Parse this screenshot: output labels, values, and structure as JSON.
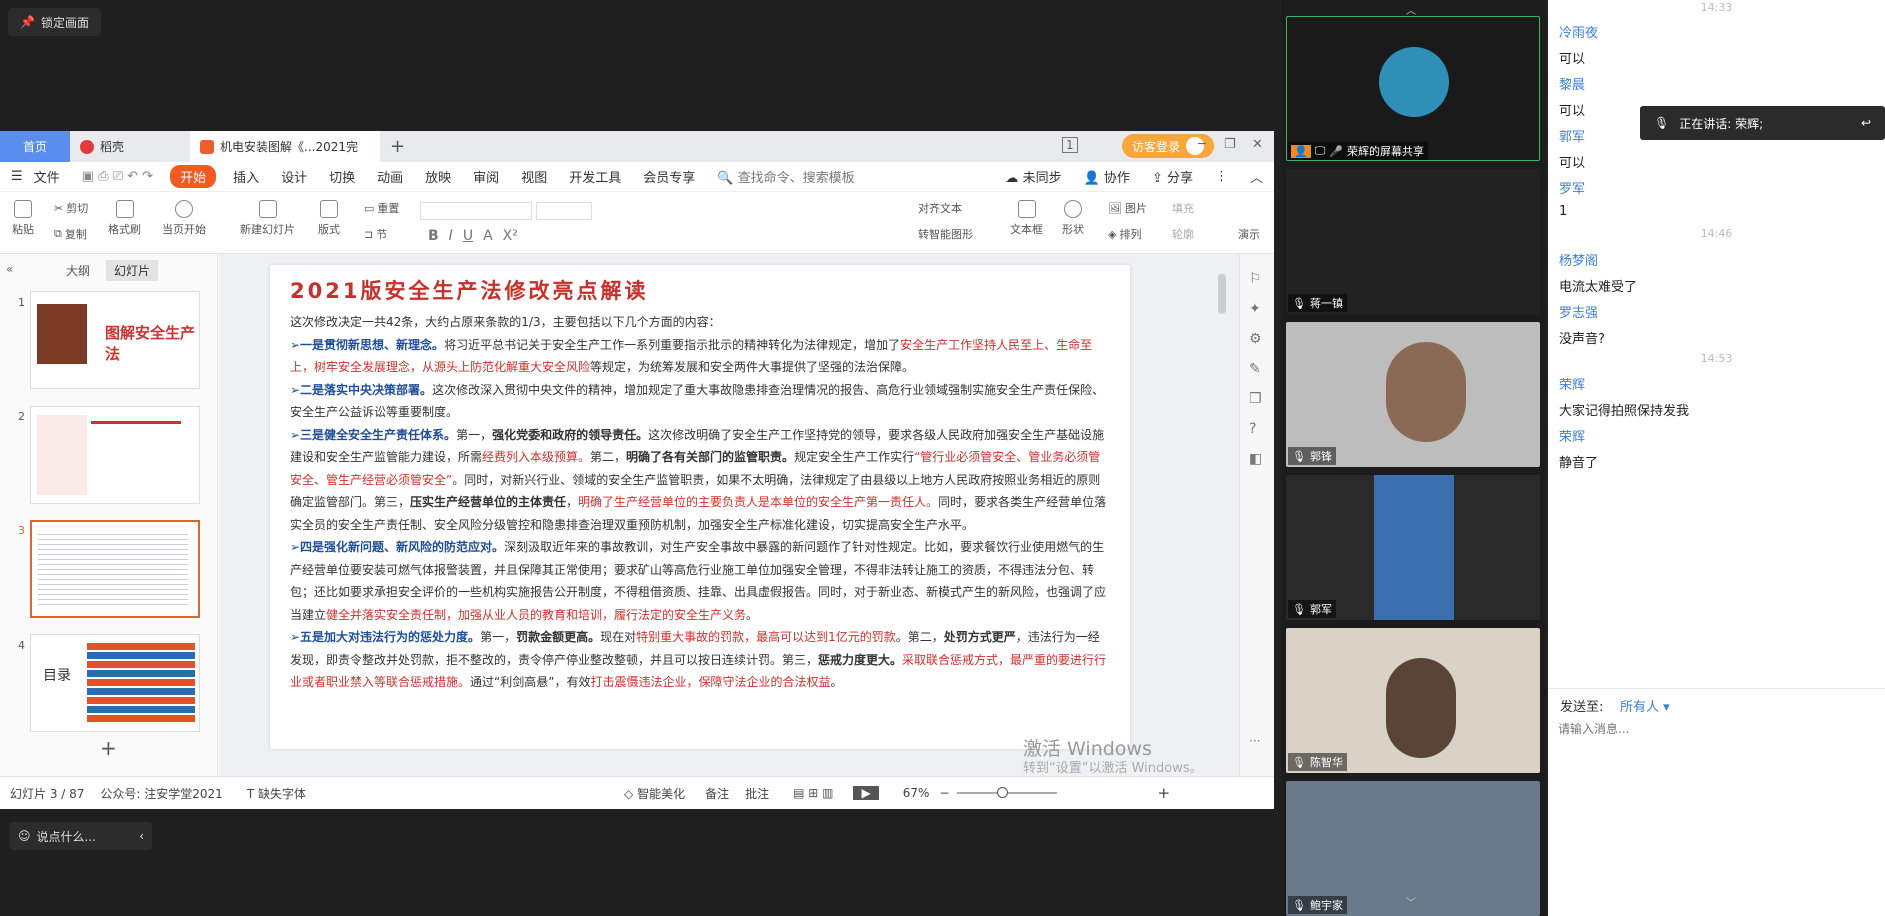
{
  "lock_label": "锁定画面",
  "tabs": {
    "home": "首页",
    "daoke": "稻壳",
    "doc": "机电安装图解《...2021完",
    "visitor": "访客登录"
  },
  "menu": {
    "file": "文件",
    "items": [
      "开始",
      "插入",
      "设计",
      "切换",
      "动画",
      "放映",
      "审阅",
      "视图",
      "开发工具",
      "会员专享"
    ],
    "search": "查找命令、搜索模板",
    "unsync": "未同步",
    "collab": "协作",
    "share": "分享"
  },
  "ribbon": {
    "paste": "粘贴",
    "cut": "剪切",
    "copy": "复制",
    "format_painter": "格式刷",
    "from_current": "当页开始",
    "new_slide": "新建幻灯片",
    "layout": "版式",
    "section": "节",
    "reset": "重置",
    "align_text": "对齐文本",
    "convert_smartart": "转智能图形",
    "textbox": "文本框",
    "shape": "形状",
    "picture": "图片",
    "arrange": "排列",
    "fill": "填充",
    "outline": "轮廓",
    "present": "演示"
  },
  "panel": {
    "outline_tab": "大纲",
    "slides_tab": "幻灯片",
    "nums": [
      "1",
      "2",
      "3",
      "4"
    ],
    "t1_title": "图解安全生产法",
    "t4_title": "目录"
  },
  "slide": {
    "title": "2021版安全生产法修改亮点解读",
    "intro": "这次修改决定一共42条，大约占原来条款的1/3，主要包括以下几个方面的内容：",
    "p1": [
      "➢一是贯彻新思想、新理念。",
      "将习近平总书记关于安全生产工作一系列重要指示批示的精神转化为法律规定，增加了",
      "安全生产工作坚持人民至上、生命至上，树牢安全发展理念，从源头上防范化解重大安全风险",
      "等规定，为统筹发展和安全两件大事提供了坚强的法治保障。"
    ],
    "p2": [
      "➢二是落实中央决策部署。",
      "这次修改深入贯彻中央文件的精神，增加规定了重大事故隐患排查治理情况的报告、高危行业领域强制实施安全生产责任保险、安全生产公益诉讼等重要制度。"
    ],
    "p3": [
      "➢三是健全安全生产责任体系。",
      "第一，",
      "强化党委和政府的领导责任。",
      "这次修改明确了安全生产工作坚持党的领导，要求各级人民政府加强安全生产基础设施建设和安全生产监管能力建设，所需",
      "经费列入本级预算。",
      "第二，",
      "明确了各有关部门的监管职责。",
      "规定安全生产工作实行",
      "“管行业必须管安全、管业务必须管安全、管生产经营必须管安全”",
      "。同时，对新兴行业、领域的安全生产监管职责，如果不太明确，法律规定了由县级以上地方人民政府按照业务相近的原则确定监管部门。第三，",
      "压实生产经营单位的主体责任",
      "，",
      "明确了生产经营单位的主要负责人是本单位的安全生产第一责任人。",
      "同时，要求各类生产经营单位落实全员的安全生产责任制、安全风险分级管控和隐患排查治理双重预防机制，加强安全生产标准化建设，切实提高安全生产水平。"
    ],
    "p4": [
      "➢四是强化新问题、新风险的防范应对。",
      "深刻汲取近年来的事故教训，对生产安全事故中暴露的新问题作了针对性规定。比如，要求餐饮行业使用燃气的生产经营单位要安装可燃气体报警装置，并且保障其正常使用；要求矿山等高危行业施工单位加强安全管理，不得非法转让施工的资质，不得违法分包、转包；还比如要求承担安全评价的一些机构实施报告公开制度，不得租借资质、挂靠、出具虚假报告。同时，对于新业态、新模式产生的新风险，也强调了应当建立",
      "健全并落实安全责任制，加强从业人员的教育和培训，履行法定的安全生产义务",
      "。"
    ],
    "p5": [
      "➢五是加大对违法行为的惩处力度。",
      "第一，",
      "罚款金额更高。",
      "现在对",
      "特别重大事故的罚款，最高可以达到1亿元的罚款",
      "。第二，",
      "处罚方式更严",
      "，违法行为一经发现，即责令整改并处罚款，拒不整改的，责令停产停业整改整顿，并且可以按日连续计罚。第三，",
      "惩戒力度更大。",
      "采取联合惩戒方式，最严重的要进行行业或者职业禁入等联合惩戒措施。",
      "通过“利剑高悬”，有效",
      "打击震慑违法企业，保障守法企业的合法权益",
      "。"
    ],
    "watermark1": "激活 Windows",
    "watermark2": "转到“设置”以激活 Windows。"
  },
  "status": {
    "slide_count": "幻灯片 3 / 87",
    "account": "公众号: 注安学堂2021",
    "missing_font": "缺失字体",
    "beautify": "智能美化",
    "notes": "备注",
    "annotate": "批注",
    "zoom": "67%"
  },
  "say": "说点什么...",
  "videos": [
    {
      "name": "荣辉的屏幕共享"
    },
    {
      "name": "蒋一镇"
    },
    {
      "name": "郭锋"
    },
    {
      "name": "郭军"
    },
    {
      "name": "陈智华"
    },
    {
      "name": "鲍宇家"
    }
  ],
  "speaking": "正在讲话: 荣辉;",
  "chat": {
    "messages": [
      {
        "time": "14:33"
      },
      {
        "name": "冷雨夜",
        "text": "可以"
      },
      {
        "name": "黎晨",
        "text": "可以"
      },
      {
        "name": "郭军",
        "text": "可以"
      },
      {
        "name": "罗军",
        "text": "1"
      },
      {
        "time": "14:46"
      },
      {
        "name": "杨梦阁",
        "text": "电流太难受了"
      },
      {
        "name": "罗志强",
        "text": "没声音?"
      },
      {
        "time": "14:53"
      },
      {
        "name": "荣辉",
        "text": "大家记得拍照保持发我"
      },
      {
        "name": "荣辉",
        "text": "静音了"
      }
    ],
    "send_to_label": "发送至:",
    "send_to_value": "所有人 ▾",
    "input_placeholder": "请输入消息..."
  }
}
